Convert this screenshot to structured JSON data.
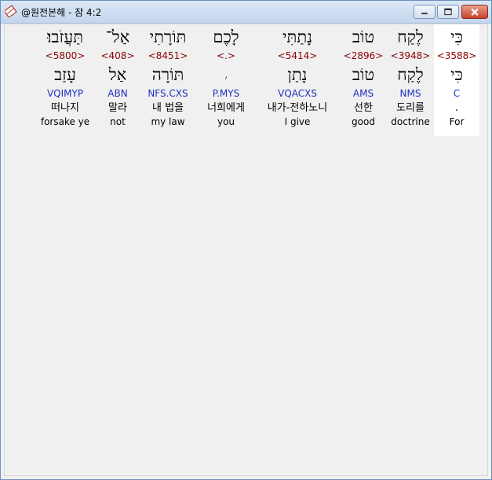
{
  "window": {
    "title": "@원전본해 - 잠 4:2",
    "icon": "app-book-icon"
  },
  "controls": {
    "minimize": "minimize-icon",
    "maximize": "maximize-icon",
    "close": "close-icon"
  },
  "words": [
    {
      "surface": "כִּי",
      "strong": "<3588>",
      "lemma": "כִּי",
      "morph": "C",
      "korean": ".",
      "english": "For",
      "selected": true
    },
    {
      "surface": "לֶקַח",
      "strong": "<3948>",
      "lemma": "לֶקַח",
      "morph": "NMS",
      "korean": "도리를",
      "english": "doctrine"
    },
    {
      "surface": "טוֹב",
      "strong": "<2896>",
      "lemma": "טוֹב",
      "morph": "AMS",
      "korean": "선한",
      "english": "good"
    },
    {
      "surface": "נָתַתִּי",
      "strong": "<5414>",
      "lemma": "נָתַן",
      "morph": "VQACXS",
      "korean": "내가-전하노니",
      "english": "I give"
    },
    {
      "surface": "לָכֶם",
      "strong": "<.>",
      "lemma": "׳",
      "morph": "P.MYS",
      "korean": "너희에게",
      "english": "you"
    },
    {
      "surface": "תּוֹרָתִי",
      "strong": "<8451>",
      "lemma": "תּוֹרָה",
      "morph": "NFS.CXS",
      "korean": "내 법을",
      "english": "my law"
    },
    {
      "surface": "אַל־",
      "strong": "<408>",
      "lemma": "אַל",
      "morph": "ABN",
      "korean": "말라",
      "english": "not"
    },
    {
      "surface": "תַּעֲזֹבוּ׃",
      "strong": "<5800>",
      "lemma": "עָזַב",
      "morph": "VQIMYP",
      "korean": "떠나지",
      "english": "forsake ye"
    }
  ]
}
